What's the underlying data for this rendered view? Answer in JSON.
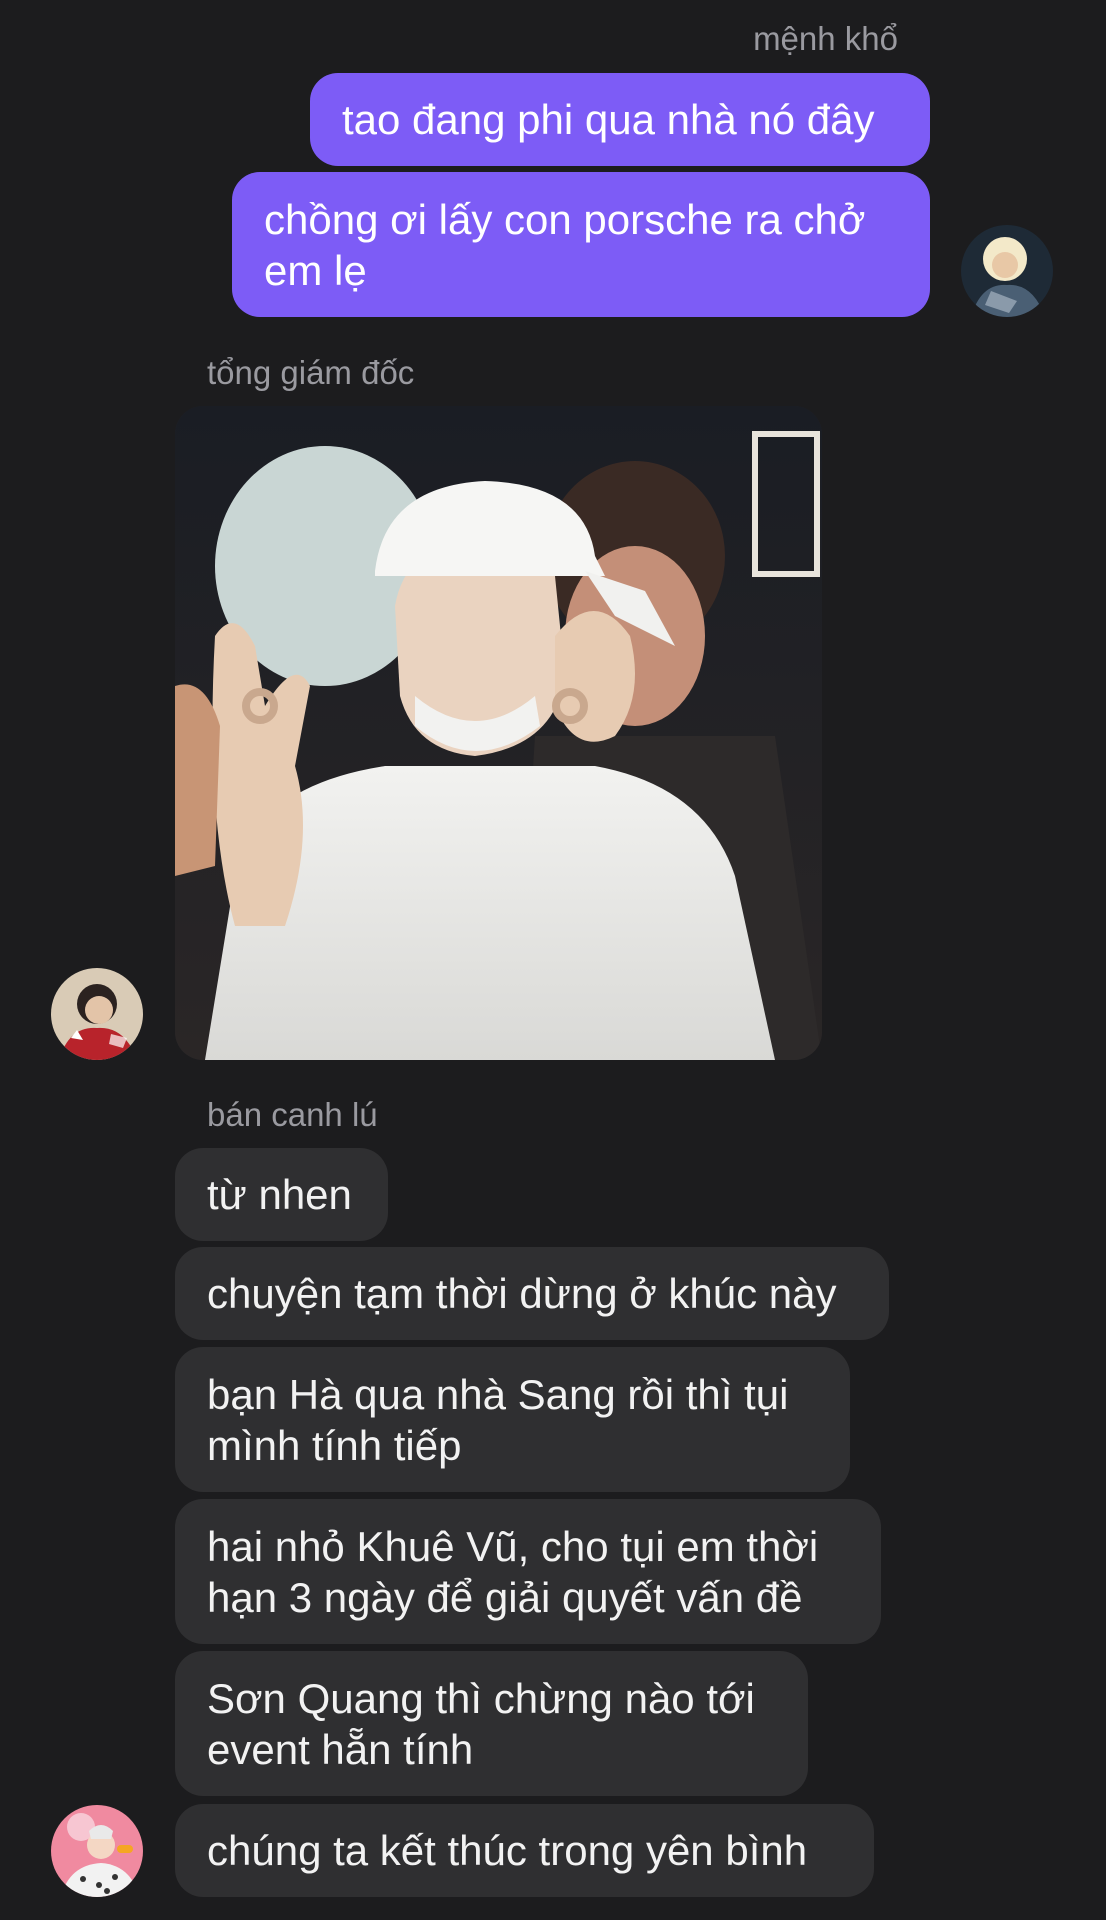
{
  "conversation": {
    "outgoing": {
      "sender_name": "mệnh khổ",
      "messages": [
        "tao đang phi qua nhà nó đây",
        "chồng ơi lấy con porsche ra chở em lẹ"
      ],
      "avatar_icon": "user-avatar-blonde"
    },
    "photo_message": {
      "sender_name": "tổng giám đốc",
      "image_icon": "photo-person-white-cap-ok-sign",
      "avatar_icon": "user-avatar-red-shirt"
    },
    "incoming": {
      "sender_name": "bán canh lú",
      "messages": [
        "từ nhen",
        "chuyện tạm thời dừng ở khúc này",
        "bạn Hà qua nhà Sang rồi thì tụi mình tính tiếp",
        "hai nhỏ Khuê Vũ, cho tụi em thời hạn 3 ngày để giải quyết vấn đề",
        "Sơn Quang thì chừng nào tới event hẵn tính",
        "chúng ta kết thúc trong yên bình"
      ],
      "avatar_icon": "user-avatar-pink"
    }
  },
  "colors": {
    "background": "#1c1c1e",
    "outgoing_bubble": "#7d5cf6",
    "incoming_bubble": "#2f2f31",
    "sender_name": "#9a9aa0"
  }
}
